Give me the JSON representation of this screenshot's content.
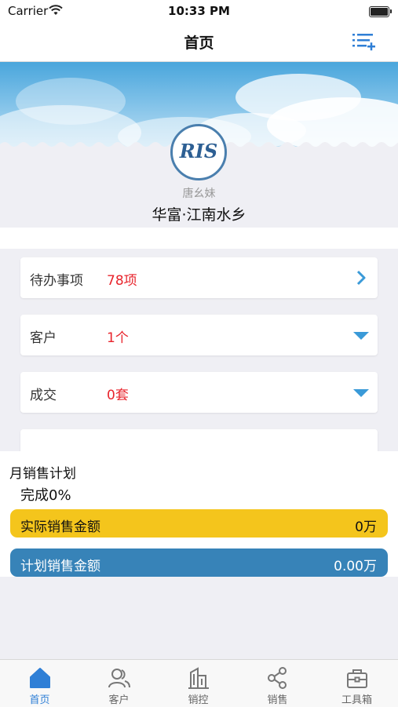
{
  "status_bar": {
    "carrier": "Carrier",
    "time": "10:33 PM"
  },
  "nav": {
    "title": "首页"
  },
  "profile": {
    "logo_text": "RIS",
    "username": "唐幺妹",
    "project": "华富·江南水乡"
  },
  "cards": [
    {
      "label": "待办事项",
      "value": "78项",
      "icon": "chevron-right-icon"
    },
    {
      "label": "客户",
      "value": "1个",
      "icon": "triangle-down-icon"
    },
    {
      "label": "成交",
      "value": "0套",
      "icon": "triangle-down-icon"
    }
  ],
  "plan": {
    "title": "月销售计划",
    "complete": "完成0%",
    "actual_label": "实际销售金额",
    "actual_value": "0万",
    "planned_label": "计划销售金额",
    "planned_value": "0.00万"
  },
  "tabs": [
    {
      "label": "首页",
      "icon": "home-icon",
      "active": true
    },
    {
      "label": "客户",
      "icon": "users-icon",
      "active": false
    },
    {
      "label": "销控",
      "icon": "building-icon",
      "active": false
    },
    {
      "label": "销售",
      "icon": "share-icon",
      "active": false
    },
    {
      "label": "工具箱",
      "icon": "toolbox-icon",
      "active": false
    }
  ],
  "colors": {
    "accent": "#2f7fd6",
    "value_red": "#e8242c",
    "actual_bar": "#f4c51c",
    "plan_bar": "#3783b8"
  }
}
